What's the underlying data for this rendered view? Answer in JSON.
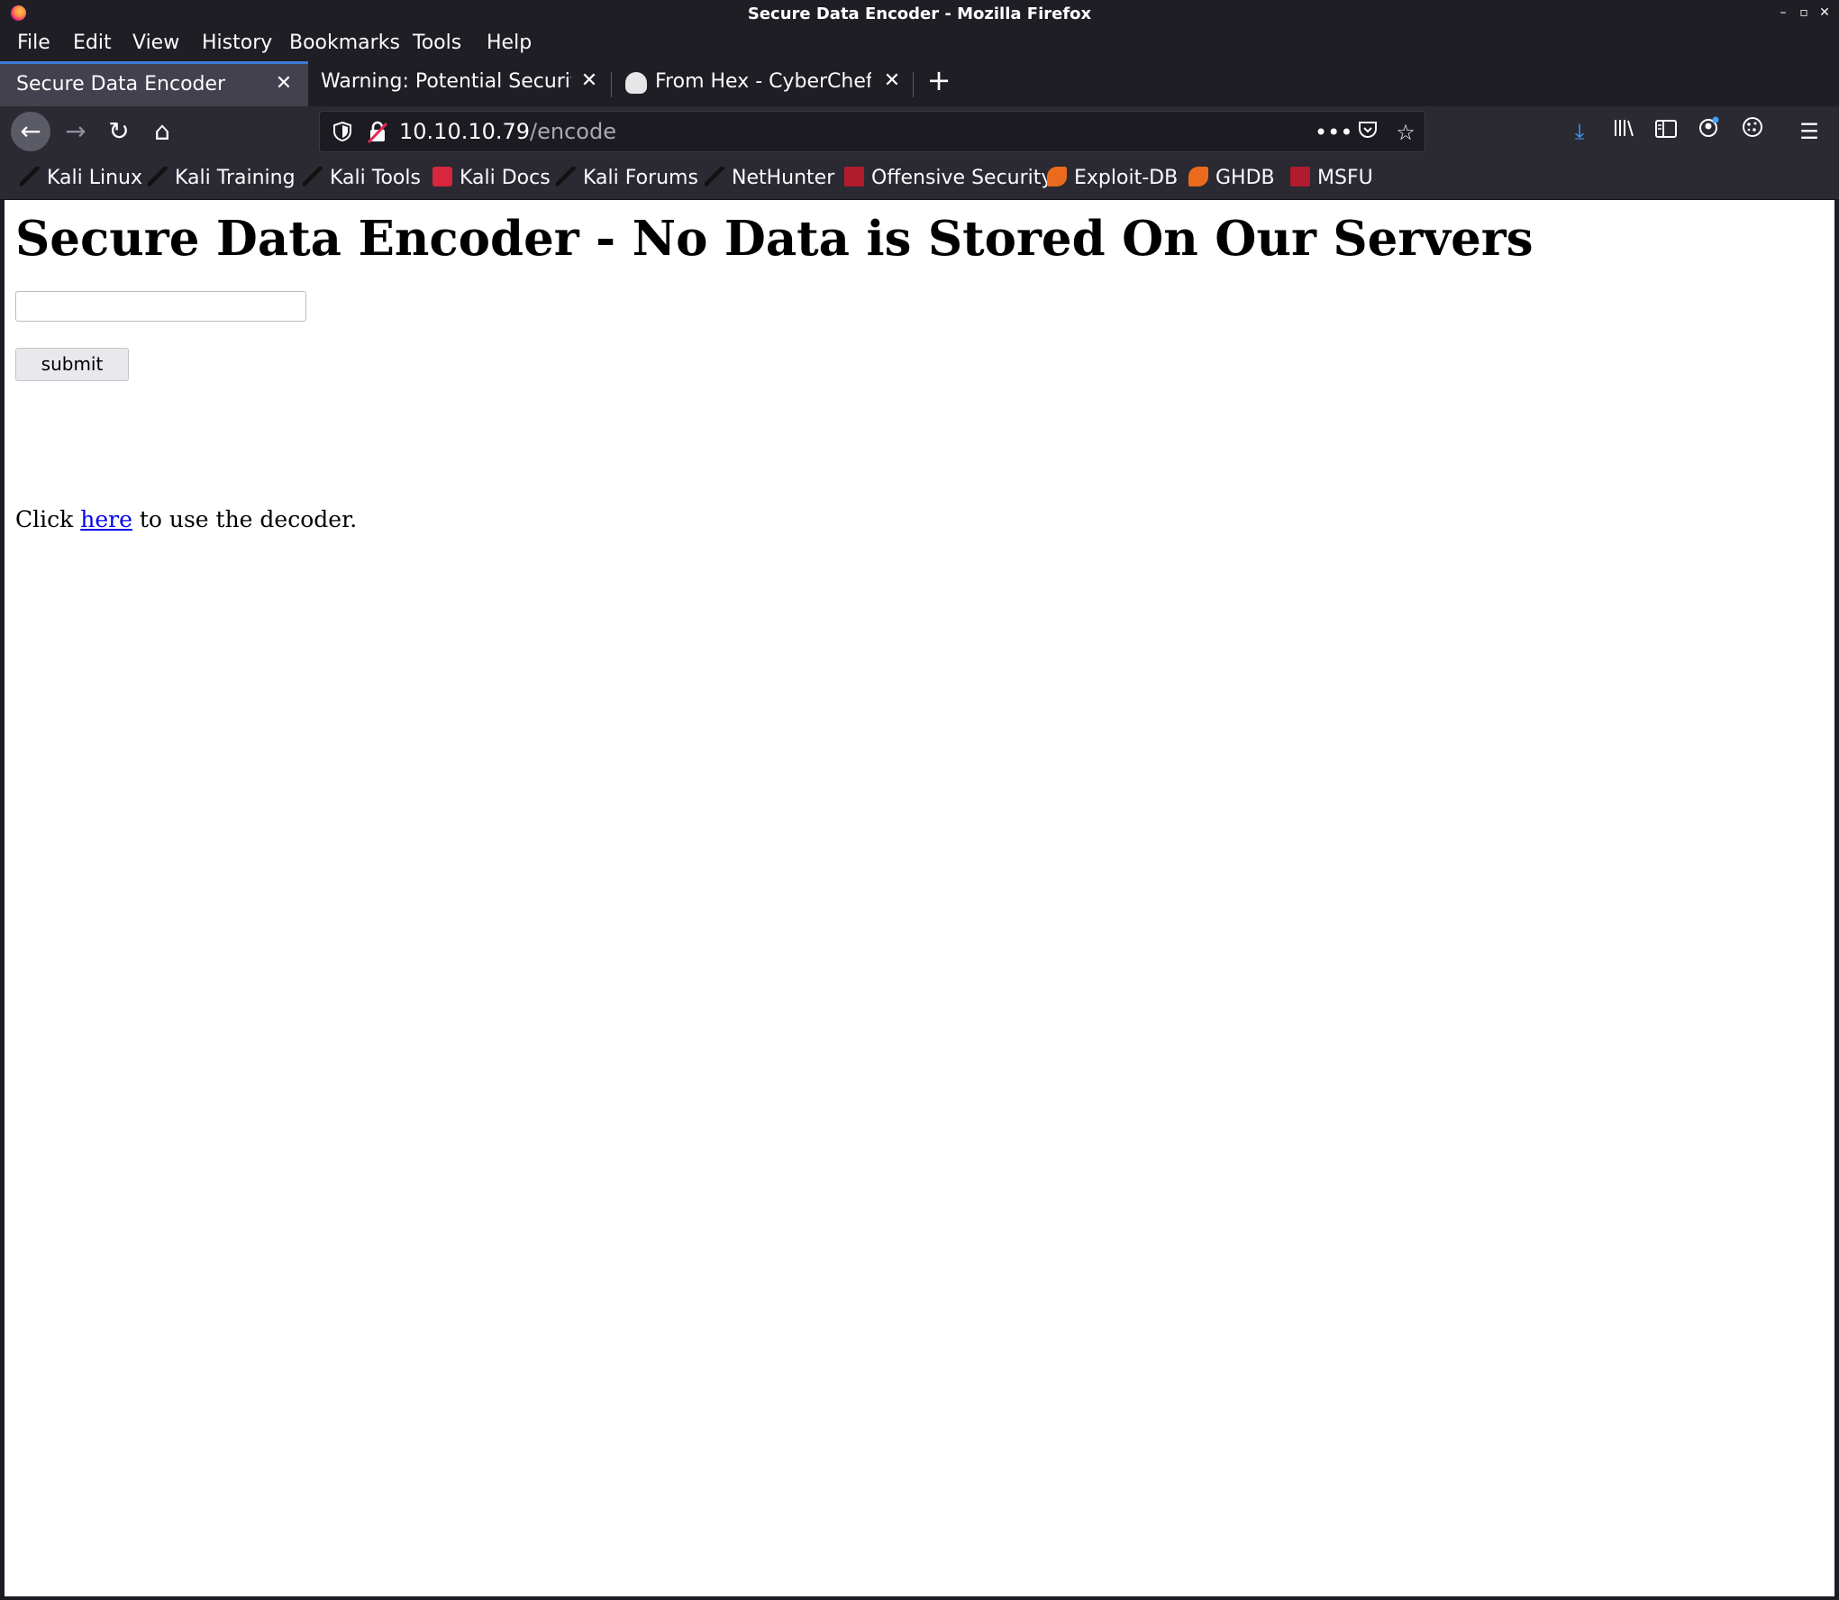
{
  "window": {
    "title": "Secure Data Encoder - Mozilla Firefox",
    "controls": [
      "minimize-icon",
      "maximize-icon",
      "close-icon"
    ]
  },
  "menu": [
    "File",
    "Edit",
    "View",
    "History",
    "Bookmarks",
    "Tools",
    "Help"
  ],
  "tabs": [
    {
      "label": "Secure Data Encoder",
      "active": true
    },
    {
      "label": "Warning: Potential Security Risk Ahead",
      "active": false
    },
    {
      "label": "From Hex - CyberChef",
      "active": false
    }
  ],
  "nav": {
    "url_host": "10.10.10.79",
    "url_path": "/encode"
  },
  "bookmarks": [
    {
      "label": "Kali Linux",
      "icon": "kali-dragon-icon"
    },
    {
      "label": "Kali Training",
      "icon": "kali-dragon-icon"
    },
    {
      "label": "Kali Tools",
      "icon": "kali-dragon-icon"
    },
    {
      "label": "Kali Docs",
      "icon": "kali-docs-icon"
    },
    {
      "label": "Kali Forums",
      "icon": "kali-dragon-icon"
    },
    {
      "label": "NetHunter",
      "icon": "kali-dragon-icon"
    },
    {
      "label": "Offensive Security",
      "icon": "offsec-icon"
    },
    {
      "label": "Exploit-DB",
      "icon": "exploit-db-icon"
    },
    {
      "label": "GHDB",
      "icon": "exploit-db-icon"
    },
    {
      "label": "MSFU",
      "icon": "offsec-icon"
    }
  ],
  "page": {
    "heading": "Secure Data Encoder - No Data is Stored On Our Servers",
    "input_value": "",
    "submit_label": "submit",
    "click_prefix": "Click ",
    "link_text": "here",
    "click_suffix": " to use the decoder."
  },
  "colors": {
    "chrome_dark": "#1f1e25",
    "toolbar": "#2b2a33",
    "active_tab": "#42414d",
    "tab_accent": "#3b7bd6",
    "link": "#0000ee",
    "download_icon": "#3fa0ff"
  }
}
